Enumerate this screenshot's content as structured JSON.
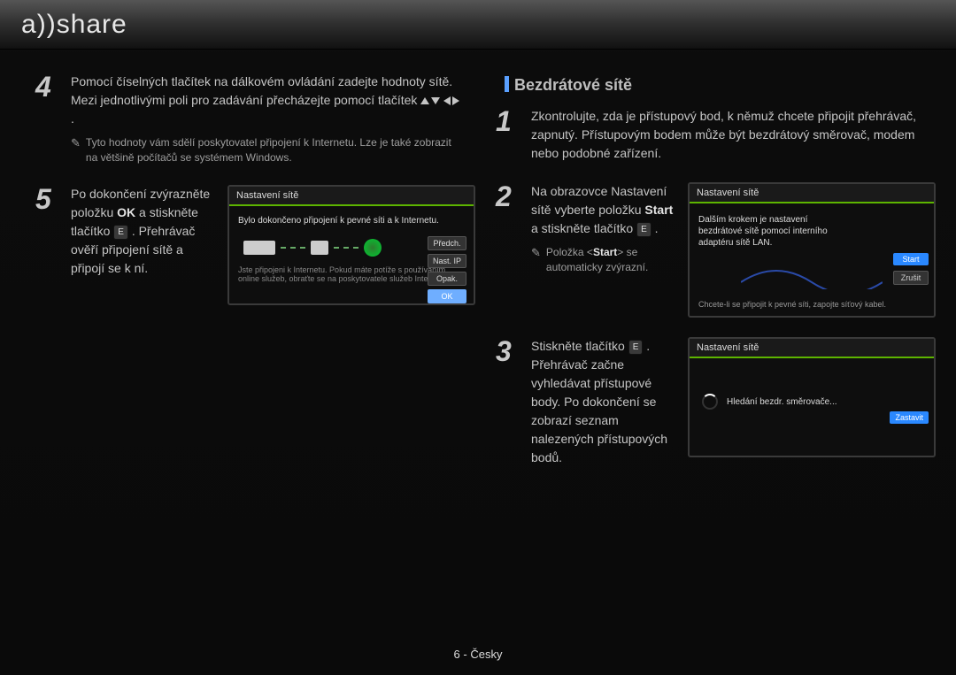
{
  "logo_text_a": "a",
  "logo_text_b": "share",
  "left": {
    "step4": {
      "num": "4",
      "text_a": "Pomocí číselných tlačítek na dálkovém ovládání zadejte hodnoty sítě. Mezi jednotlivými poli pro zadávání přecházejte pomocí tlačítek ",
      "note": "Tyto hodnoty vám sdělí poskytovatel připojení k Internetu. Lze je také zobrazit na většině počítačů se systémem Windows."
    },
    "step5": {
      "num": "5",
      "text_a": "Po dokončení zvýrazněte položku ",
      "bold1": "OK",
      "text_b": " a stiskněte tlačítko ",
      "enter": "E",
      "text_c": ". Přehrávač ověří připojení sítě a připojí se k ní."
    }
  },
  "right_title": "Bezdrátové sítě",
  "right": {
    "step1": {
      "num": "1",
      "text": "Zkontrolujte, zda je přístupový bod, k němuž chcete připojit přehrávač, zapnutý. Přístupovým bodem může být bezdrátový směrovač, modem nebo podobné zařízení."
    },
    "step2": {
      "num": "2",
      "text_a": "Na obrazovce Nastavení sítě vyberte položku ",
      "bold1": "Start",
      "text_b": " a stiskněte tlačítko ",
      "enter": "E",
      "text_c": ".",
      "note_a": "Položka <",
      "note_bold": "Start",
      "note_b": "> se automaticky zvýrazní."
    },
    "step3": {
      "num": "3",
      "text_a": "Stiskněte tlačítko ",
      "enter": "E",
      "text_b": ". Přehrávač začne vyhledávat přístupové body. Po dokončení se zobrazí seznam nalezených přístupových bodů."
    }
  },
  "panel1": {
    "title": "Nastavení sítě",
    "msg": "Bylo dokončeno připojení k pevné síti a k Internetu.",
    "btn1": "Předch.",
    "btn2": "Nast. IP",
    "btn3": "Opak.",
    "btn4": "OK",
    "footer": "Jste připojeni k Internetu. Pokud máte potíže s používáním online služeb, obraťte se na poskytovatele služeb Internetu."
  },
  "panel2": {
    "title": "Nastavení sítě",
    "msg": "Dalším krokem je nastavení bezdrátové sítě pomocí interního adaptéru sítě LAN.",
    "start": "Start",
    "cancel": "Zrušit",
    "hint": "Chcete-li se připojit k pevné síti, zapojte síťový kabel."
  },
  "panel3": {
    "title": "Nastavení sítě",
    "searching": "Hledání bezdr. směrovače...",
    "stop": "Zastavit"
  },
  "footer": "6 - Česky"
}
